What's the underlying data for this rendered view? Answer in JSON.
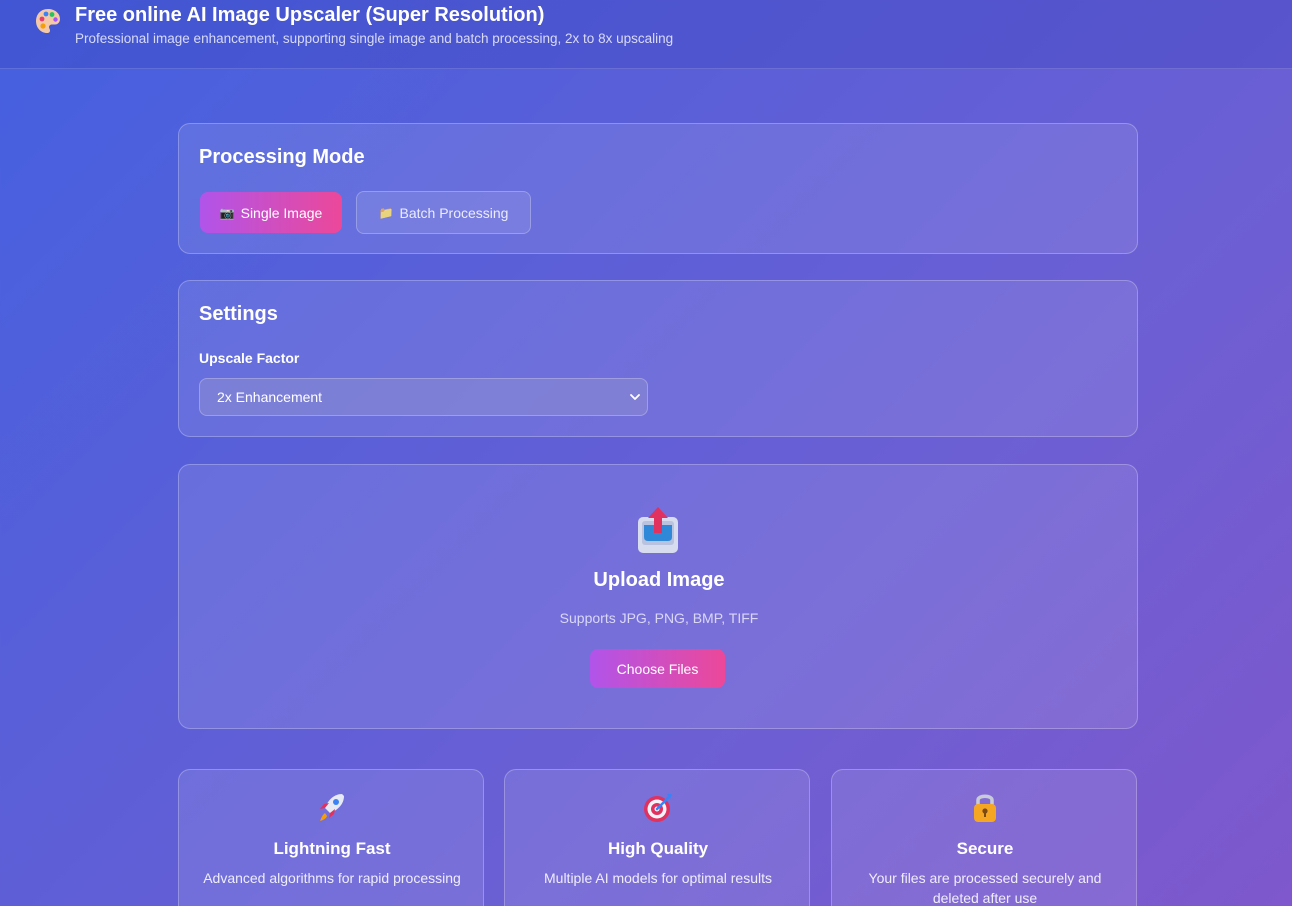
{
  "header": {
    "logo_icon": "palette-icon",
    "title": "Free online AI Image Upscaler (Super Resolution)",
    "subtitle": "Professional image enhancement, supporting single image and batch processing, 2x to 8x upscaling"
  },
  "mode": {
    "title": "Processing Mode",
    "single_icon": "camera-icon",
    "single_label": "Single Image",
    "batch_icon": "folder-icon",
    "batch_label": "Batch Processing",
    "active": "single"
  },
  "settings": {
    "title": "Settings",
    "upscale_label": "Upscale Factor",
    "upscale_value": "2x Enhancement"
  },
  "upload": {
    "icon": "upload-tray-icon",
    "title": "Upload Image",
    "formats": "Supports JPG, PNG, BMP, TIFF",
    "button_label": "Choose Files"
  },
  "features": [
    {
      "icon": "rocket-icon",
      "title": "Lightning Fast",
      "desc": "Advanced algorithms for rapid processing"
    },
    {
      "icon": "target-icon",
      "title": "High Quality",
      "desc": "Multiple AI models for optimal results"
    },
    {
      "icon": "lock-icon",
      "title": "Secure",
      "desc": "Your files are processed securely and deleted after use"
    }
  ],
  "colors": {
    "accent_start": "#b154ea",
    "accent_end": "#ec4899"
  }
}
